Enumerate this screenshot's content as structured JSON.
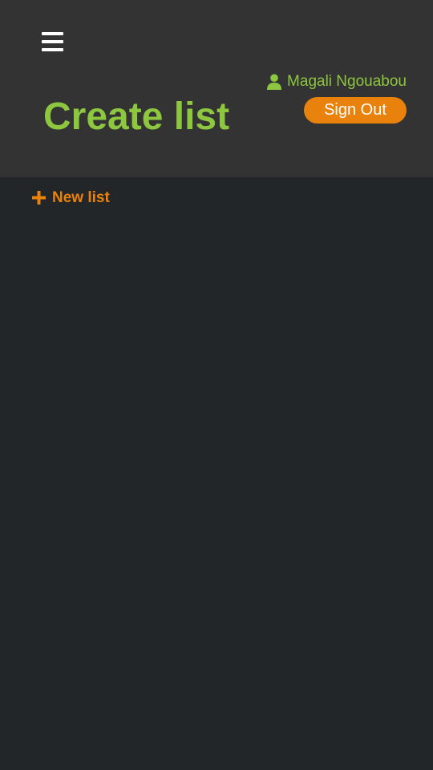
{
  "header": {
    "title": "Create list",
    "menu_icon": "hamburger-menu-icon",
    "user": {
      "icon": "user-icon",
      "name": "Magali Ngouabou"
    },
    "sign_out_label": "Sign Out"
  },
  "main": {
    "new_list": {
      "icon": "plus-icon",
      "label": "New list"
    }
  },
  "colors": {
    "header_bg": "#333333",
    "page_bg": "#232629",
    "accent_green": "#8dc63f",
    "accent_orange": "#e8820c",
    "text_white": "#ffffff"
  }
}
